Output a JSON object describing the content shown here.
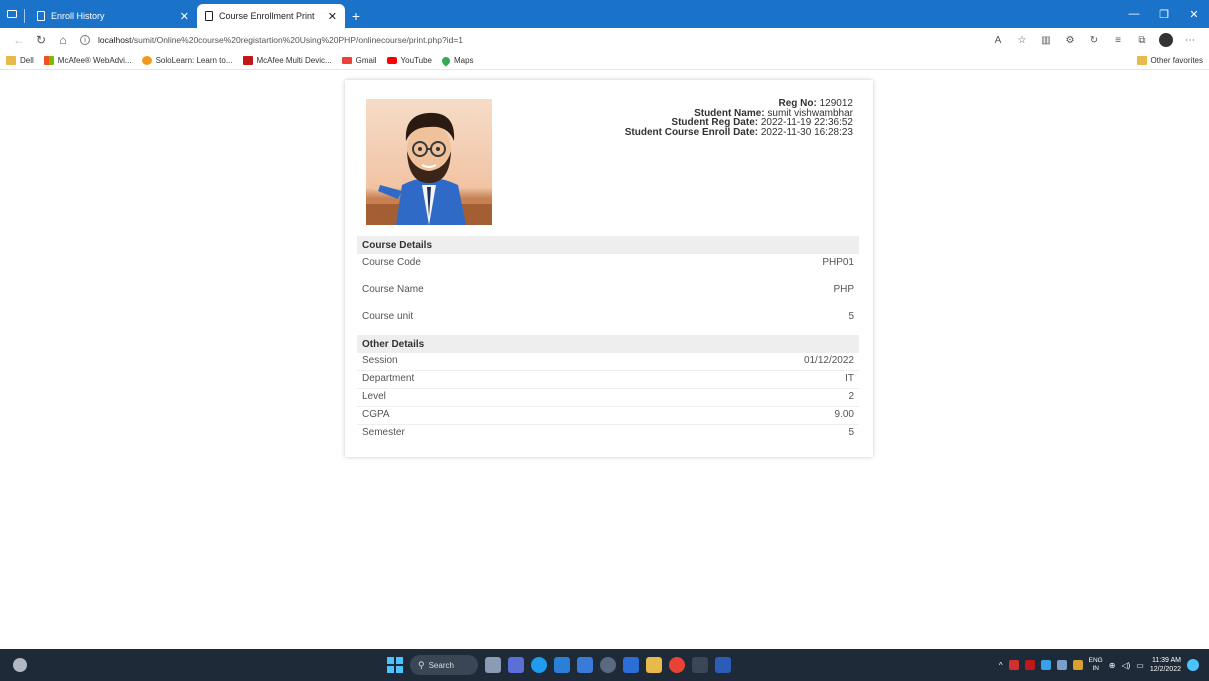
{
  "browser": {
    "tabs": [
      {
        "label": "Enroll History",
        "active": false
      },
      {
        "label": "Course Enrollment Print",
        "active": true
      }
    ],
    "url_host": "localhost",
    "url_path": "/sumit/Online%20course%20registartion%20Using%20PHP/onlinecourse/print.php?id=1",
    "favorites": [
      "Dell",
      "McAfee® WebAdvi...",
      "SoloLearn: Learn to...",
      "McAfee Multi Devic...",
      "Gmail",
      "YouTube",
      "Maps"
    ],
    "other_favorites": "Other favorites",
    "accent": "#1a73c8"
  },
  "student": {
    "reg_no_label": "Reg No:",
    "reg_no": "129012",
    "name_label": "Student Name:",
    "name": "sumit vishwambhar",
    "reg_date_label": "Student Reg Date:",
    "reg_date": "2022-11-19 22:36:52",
    "enroll_date_label": "Student Course Enroll Date:",
    "enroll_date": "2022-11-30 16:28:23"
  },
  "course_details": {
    "title": "Course Details",
    "rows": [
      {
        "label": "Course Code",
        "value": "PHP01"
      },
      {
        "label": "Course Name",
        "value": "PHP"
      },
      {
        "label": "Course unit",
        "value": "5"
      }
    ]
  },
  "other_details": {
    "title": "Other Details",
    "rows": [
      {
        "label": "Session",
        "value": "01/12/2022"
      },
      {
        "label": "Department",
        "value": "IT"
      },
      {
        "label": "Level",
        "value": "2"
      },
      {
        "label": "CGPA",
        "value": "9.00"
      },
      {
        "label": "Semester",
        "value": "5"
      }
    ]
  },
  "taskbar": {
    "search_label": "Search",
    "lang_top": "ENG",
    "lang_bottom": "IN",
    "time": "11:39 AM",
    "date": "12/2/2022"
  }
}
